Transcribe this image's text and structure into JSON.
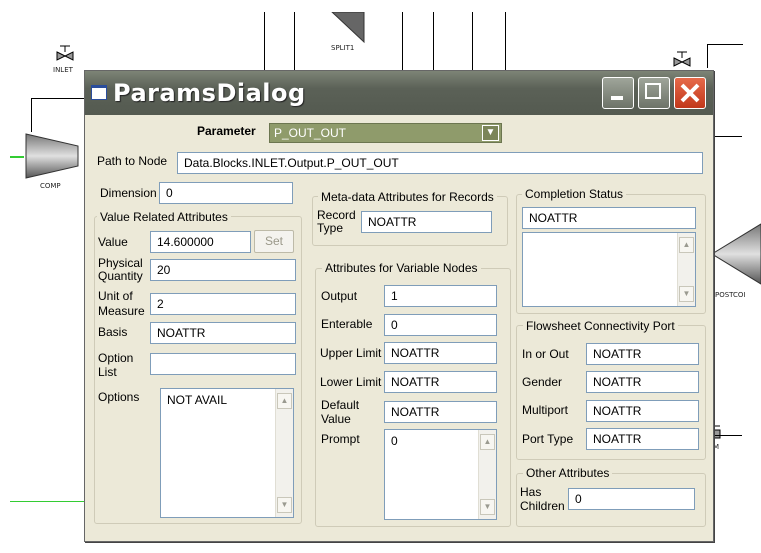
{
  "background": {
    "inlet_label": "INLET",
    "split_label": "SPLIT1",
    "comp_label": "COMP",
    "postcomp_label": "POSTCOI",
    "partial_label": "M"
  },
  "dialog": {
    "title": "ParamsDialog",
    "parameter_label": "Parameter",
    "parameter_value": "P_OUT_OUT",
    "path_label": "Path to Node",
    "path_value": "Data.Blocks.INLET.Output.P_OUT_OUT",
    "dimension_label": "Dimension",
    "dimension_value": "0",
    "value_group": {
      "title": "Value Related Attributes",
      "value_label": "Value",
      "value": "14.600000",
      "set_label": "Set",
      "physical_label_1": "Physical",
      "physical_label_2": "Quantity",
      "physical_value": "20",
      "unit_label_1": "Unit of",
      "unit_label_2": "Measure",
      "unit_value": "2",
      "basis_label": "Basis",
      "basis_value": "NOATTR",
      "option_label_1": "Option",
      "option_label_2": "List",
      "option_value": "",
      "options_label": "Options",
      "options_value": "NOT AVAIL"
    },
    "meta_group": {
      "title": "Meta-data Attributes for Records",
      "record_label_1": "Record",
      "record_label_2": "Type",
      "record_value": "NOATTR"
    },
    "variable_group": {
      "title": "Attributes for Variable Nodes",
      "output_label": "Output",
      "output_value": "1",
      "enterable_label": "Enterable",
      "enterable_value": "0",
      "upper_label": "Upper Limit",
      "upper_value": "NOATTR",
      "lower_label": "Lower Limit",
      "lower_value": "NOATTR",
      "default_label_1": "Default",
      "default_label_2": "Value",
      "default_value": "NOATTR",
      "prompt_label": "Prompt",
      "prompt_value": "0"
    },
    "completion_group": {
      "title": "Completion Status",
      "status_value": "NOATTR"
    },
    "flowsheet_group": {
      "title": "Flowsheet Connectivity Port",
      "inout_label": "In or Out",
      "inout_value": "NOATTR",
      "gender_label": "Gender",
      "gender_value": "NOATTR",
      "multiport_label": "Multiport",
      "multiport_value": "NOATTR",
      "porttype_label": "Port Type",
      "porttype_value": "NOATTR"
    },
    "other_group": {
      "title": "Other Attributes",
      "has_label_1": "Has",
      "has_label_2": "Children",
      "has_value": "0"
    }
  },
  "colors": {
    "dialog_bg": "#ece9d8",
    "titlebar": "#5b6157",
    "combo_bg": "#8f9b6b",
    "close_button": "#c2381b",
    "stream_green": "#33cc33"
  }
}
